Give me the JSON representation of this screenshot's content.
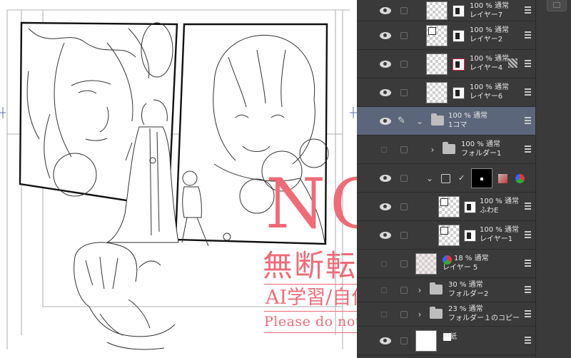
{
  "watermark": {
    "headline": "NG",
    "notice_jp": "無断転載",
    "notice_ai": "AI学習/自作発言",
    "notice_en": "Please do not repost."
  },
  "layer_panel": {
    "layers": [
      {
        "blend": "100 % 通常",
        "name": "レイヤー7",
        "kind": "raster",
        "visible": true
      },
      {
        "blend": "100 % 通常",
        "name": "レイヤー2",
        "kind": "raster",
        "visible": true
      },
      {
        "blend": "100 % 通常",
        "name": "レイヤー4",
        "kind": "raster",
        "visible": true
      },
      {
        "blend": "100 % 通常",
        "name": "レイヤー6",
        "kind": "raster",
        "visible": true
      },
      {
        "blend": "100 % 通常",
        "name": "1コマ",
        "kind": "folder",
        "visible": true,
        "selected": true
      },
      {
        "blend": "100 % 通常",
        "name": "フォルダー1",
        "kind": "folder",
        "visible": false
      },
      {
        "blend": "",
        "name": "",
        "kind": "frame",
        "visible": true
      },
      {
        "blend": "100 % 通常",
        "name": "ふわE",
        "kind": "raster",
        "visible": true
      },
      {
        "blend": "100 % 通常",
        "name": "レイヤー1",
        "kind": "raster",
        "visible": true
      },
      {
        "blend": "18 % 通常",
        "name": "レイヤー 5",
        "kind": "raster",
        "visible": false
      },
      {
        "blend": "30 % 通常",
        "name": "フォルダー2",
        "kind": "folder",
        "visible": false
      },
      {
        "blend": "23 % 通常",
        "name": "フォルダー１のコピー",
        "kind": "folder",
        "visible": false
      },
      {
        "blend": "",
        "name": "用紙",
        "kind": "paper",
        "visible": true
      }
    ]
  },
  "colors": {
    "watermark": "#f06b78",
    "panel_bg": "#383838",
    "selected_row": "#5b667a"
  }
}
